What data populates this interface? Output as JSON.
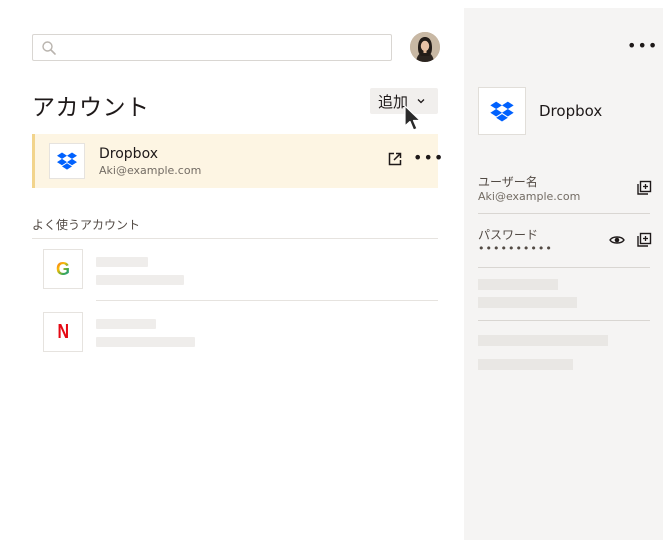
{
  "search": {
    "placeholder": ""
  },
  "accounts": {
    "title": "アカウント",
    "add_label": "追加",
    "selected": {
      "name": "Dropbox",
      "email": "Aki@example.com"
    }
  },
  "favorites": {
    "label": "よく使うアカウント",
    "items": [
      {
        "logo_letter": "G",
        "service": "google"
      },
      {
        "logo_letter": "N",
        "service": "netflix"
      }
    ]
  },
  "detail": {
    "name": "Dropbox",
    "username_label": "ユーザー名",
    "username_value": "Aki@example.com",
    "password_label": "パスワード",
    "password_value": "••••••••••"
  },
  "colors": {
    "dropbox_blue": "#0061fe",
    "selected_row_bg": "#fdf5e3",
    "selected_row_accent": "#f2d48c",
    "netflix_red": "#e50914",
    "right_pane_bg": "#f5f4f3"
  }
}
